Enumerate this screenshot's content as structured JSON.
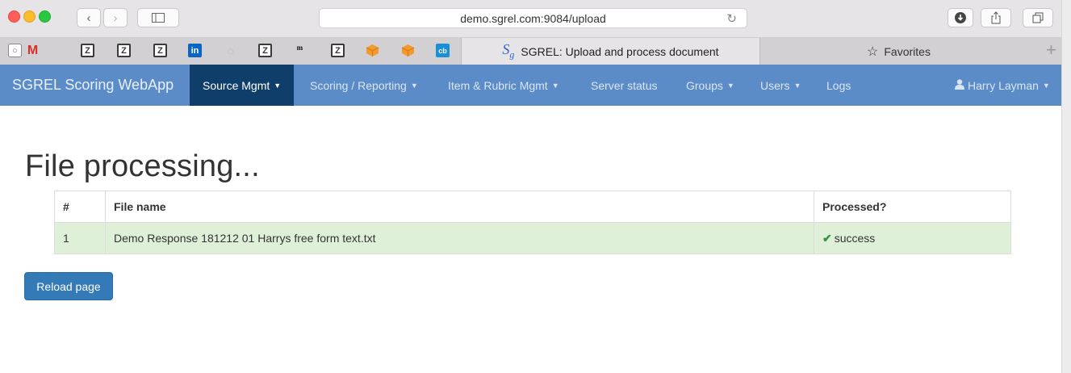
{
  "browser": {
    "url": "demo.sgrel.com:9084/upload",
    "active_tab": "SGREL: Upload and process document",
    "favorites_tab": "Favorites",
    "bookmark_icons": [
      "quora-icon",
      "gmail-icon",
      "z-icon",
      "z-icon",
      "z-icon",
      "linkedin-icon",
      "grey-icon",
      "z-icon",
      "nyt-icon",
      "z-icon",
      "cube-icon",
      "cube-icon",
      "cb-icon"
    ]
  },
  "navbar": {
    "brand": "SGREL Scoring WebApp",
    "items": [
      {
        "label": "Source Mgmt",
        "dropdown": true,
        "active": true
      },
      {
        "label": "Scoring / Reporting",
        "dropdown": true
      },
      {
        "label": "Item & Rubric Mgmt",
        "dropdown": true
      },
      {
        "label": "Server status",
        "dropdown": false
      },
      {
        "label": "Groups",
        "dropdown": true
      },
      {
        "label": "Users",
        "dropdown": true
      },
      {
        "label": "Logs",
        "dropdown": false
      }
    ],
    "user": "Harry Layman"
  },
  "page": {
    "title": "File processing...",
    "table": {
      "headers": [
        "#",
        "File name",
        "Processed?"
      ],
      "rows": [
        {
          "num": "1",
          "file": "Demo Response 181212 01 Harrys free form text.txt",
          "status": "success"
        }
      ]
    },
    "reload_label": "Reload page"
  },
  "colors": {
    "navbar_bg": "#5b8cc7",
    "nav_active_bg": "#0f3e6b",
    "success_row": "#dff0d8",
    "button_primary": "#337ab7"
  }
}
